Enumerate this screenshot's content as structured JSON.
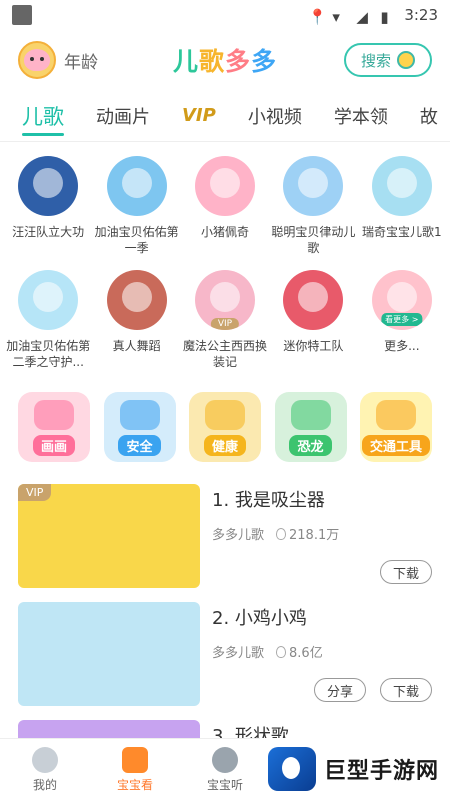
{
  "status_bar": {
    "time": "3:23"
  },
  "header": {
    "age_label": "年龄",
    "logo_text": [
      "儿",
      "歌",
      "多",
      "多"
    ],
    "search_label": "搜索"
  },
  "tabs": [
    {
      "label": "儿歌",
      "active": true
    },
    {
      "label": "动画片"
    },
    {
      "label": "VIP",
      "vip": true
    },
    {
      "label": "小视频"
    },
    {
      "label": "学本领"
    },
    {
      "label": "故"
    }
  ],
  "characters": [
    {
      "label": "汪汪队立大功",
      "color": "#2f5fa8"
    },
    {
      "label": "加油宝贝佑佑第一季",
      "color": "#7ec6f0"
    },
    {
      "label": "小猪佩奇",
      "color": "#ffb3c8"
    },
    {
      "label": "聪明宝贝律动儿歌",
      "color": "#9ed1f5"
    },
    {
      "label": "瑞奇宝宝儿歌1",
      "color": "#a7dff2"
    },
    {
      "label": "加油宝贝佑佑第二季之守护...",
      "color": "#b6e5f7"
    },
    {
      "label": "真人舞蹈",
      "color": "#c96a5a"
    },
    {
      "label": "魔法公主西西换装记",
      "color": "#f7b7c9",
      "tag": "VIP"
    },
    {
      "label": "迷你特工队",
      "color": "#e85a6a"
    },
    {
      "label": "更多...",
      "color": "#ffc2cc",
      "tag": "看更多 >"
    }
  ],
  "categories": [
    {
      "label": "画画",
      "bg": "#ffd8e2",
      "tag": "#ff6f9a"
    },
    {
      "label": "安全",
      "bg": "#d4ecfb",
      "tag": "#3aa3f0"
    },
    {
      "label": "健康",
      "bg": "#fbe9b0",
      "tag": "#f5b51d"
    },
    {
      "label": "恐龙",
      "bg": "#d7f1dc",
      "tag": "#3cc46f"
    },
    {
      "label": "交通工具",
      "bg": "#fff3b2",
      "tag": "#f7a51b"
    }
  ],
  "songs": [
    {
      "title": "1. 我是吸尘器",
      "artist": "多多儿歌",
      "plays": "218.1万",
      "vip": "VIP",
      "buttons": [
        "下载"
      ],
      "bg": "#f9d74a"
    },
    {
      "title": "2. 小鸡小鸡",
      "artist": "多多儿歌",
      "plays": "8.6亿",
      "buttons": [
        "分享",
        "下载"
      ],
      "bg": "#bfe6f5"
    },
    {
      "title": "3. 形状歌",
      "partial": true,
      "bg": "#c7a3f0"
    }
  ],
  "bottom_nav": [
    {
      "label": "我的"
    },
    {
      "label": "宝宝看",
      "active": true
    },
    {
      "label": "宝宝听"
    }
  ],
  "watermark": {
    "text": "巨型手游网"
  }
}
